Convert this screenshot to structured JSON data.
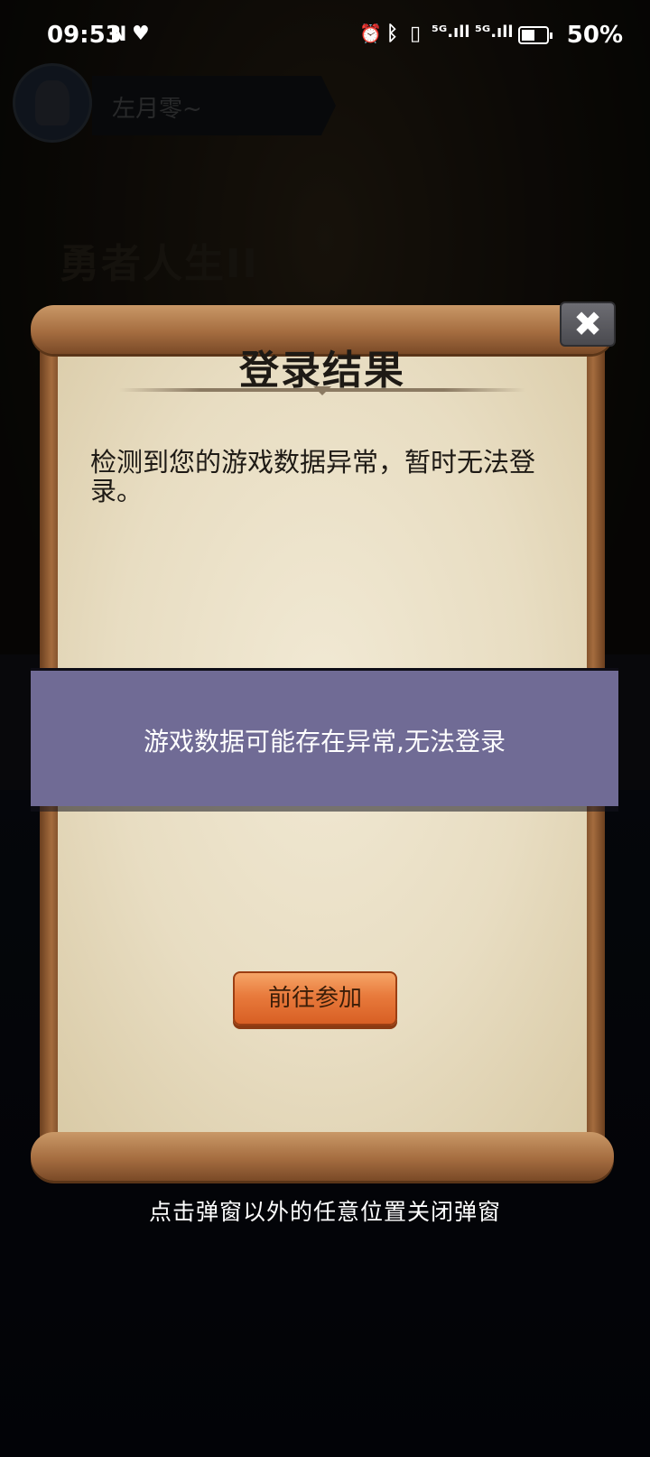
{
  "status_bar": {
    "time": "09:53",
    "nfc_icon": "N",
    "heart_icon": "♥",
    "alarm_icon": "⏰",
    "bluetooth_icon": "ᛒ",
    "vibrate_icon": "▯",
    "signal1": "⁵ᴳ.ıll",
    "signal2": "⁵ᴳ.ıll",
    "battery_percent": "50%"
  },
  "background": {
    "username": "左月零~",
    "game_title": "勇者人生II"
  },
  "dialog": {
    "title": "登录结果",
    "message": "检测到您的游戏数据异常，暂时无法登录。",
    "close_symbol": "✖",
    "join_button": "前往参加"
  },
  "toast": {
    "text": "游戏数据可能存在异常,无法登录"
  },
  "hint": {
    "text": "点击弹窗以外的任意位置关闭弹窗"
  },
  "colors": {
    "toast_bg": "#706b95",
    "button_orange": "#e87a3c",
    "parchment": "#ece3cb",
    "wood": "#a56d40"
  }
}
